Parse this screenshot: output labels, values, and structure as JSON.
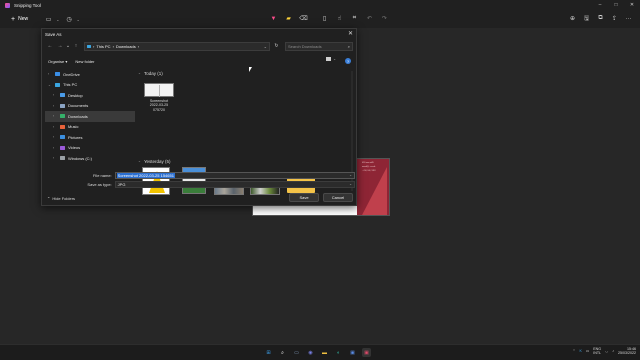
{
  "app": {
    "title": "Snipping Tool"
  },
  "window_controls": {
    "minimize": "–",
    "maximize": "□",
    "close": "✕"
  },
  "toolbar": {
    "new_label": "New",
    "new_icon": "+",
    "mode_icon": "▭",
    "timer_icon": "◷",
    "ballpoint_icon": "▼",
    "highlighter_icon": "▰",
    "eraser_icon": "⌫",
    "ruler_icon": "▯",
    "touch_icon": "☝",
    "crop_icon": "⌗",
    "undo_icon": "↶",
    "redo_icon": "↷",
    "zoom_icon": "⊕",
    "save_icon": "🖫",
    "copy_icon": "⧉",
    "share_icon": "⇪",
    "more_icon": "···"
  },
  "dialog": {
    "title": "Save As",
    "close_icon": "✕",
    "nav": {
      "back": "←",
      "forward": "→",
      "dropdown": "⌄",
      "up": "↑"
    },
    "address": {
      "segments": [
        "This PC",
        "Downloads"
      ],
      "separator": "›"
    },
    "address_dropdown": "⌄",
    "refresh_icon": "↻",
    "search_placeholder": "Search Downloads",
    "search_icon": "⌕",
    "organise_label": "Organise ▾",
    "new_folder_label": "New folder",
    "help_icon": "?",
    "sidebar": [
      {
        "label": "OneDrive",
        "color": "#3a8ee6",
        "sub": false,
        "chevron": "›"
      },
      {
        "label": "This PC",
        "color": "#3aa5e0",
        "sub": false,
        "chevron": "⌄"
      },
      {
        "label": "Desktop",
        "color": "#4a9be8",
        "sub": true,
        "chevron": "›"
      },
      {
        "label": "Documents",
        "color": "#8ba4c4",
        "sub": true,
        "chevron": "›"
      },
      {
        "label": "Downloads",
        "color": "#35b06a",
        "sub": true,
        "chevron": "›",
        "selected": true
      },
      {
        "label": "Music",
        "color": "#e8623a",
        "sub": true,
        "chevron": "›"
      },
      {
        "label": "Pictures",
        "color": "#3b8fe0",
        "sub": true,
        "chevron": "›"
      },
      {
        "label": "Videos",
        "color": "#9b5ad9",
        "sub": true,
        "chevron": "›"
      },
      {
        "label": "Windows (C:)",
        "color": "#9aa0a6",
        "sub": true,
        "chevron": "›"
      }
    ],
    "groups": [
      {
        "label": "Today (1)",
        "chevron": "⌄"
      },
      {
        "label": "Yesterday (5)",
        "chevron": "⌄"
      }
    ],
    "today_files": [
      {
        "name_line1": "Screenshot",
        "name_line2": "2022-03-25",
        "name_line3": "075720"
      }
    ],
    "filename_label": "File name:",
    "filename_value": "Screenshot 2022-03-25 154651",
    "type_label": "Save as type:",
    "type_value": "JPG",
    "field_dropdown": "⌄",
    "hide_folders_label": "Hide Folders",
    "hide_folders_icon": "⌃",
    "save_label": "Save",
    "cancel_label": "Cancel"
  },
  "preview": {
    "lines": [
      "020 xxx xx05",
      "email@...co.uk",
      "...OK, UK, XXX"
    ]
  },
  "taskbar": {
    "start_icon": "⊞",
    "search_icon": "⌕",
    "widgets_icon": "▭",
    "chat_icon": "◉",
    "explorer_icon": "▬",
    "edge_icon": "◐",
    "store_icon": "▣",
    "snip_icon": "▣",
    "tray_chevron": "⌃",
    "tray_k_icon": "K",
    "tray_battery_icon": "▭",
    "tray_wifi_icon": "◡",
    "tray_volume_icon": "♪",
    "language_line1": "ENG",
    "language_line2": "INTL",
    "time": "15:46",
    "date": "25/03/2022"
  }
}
